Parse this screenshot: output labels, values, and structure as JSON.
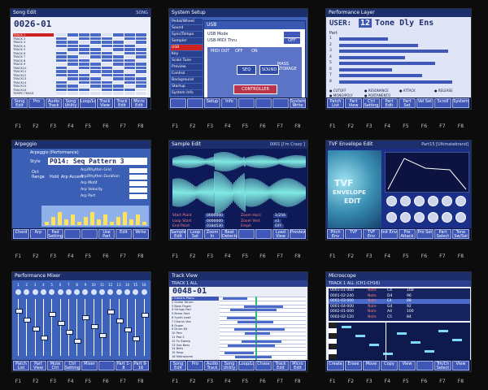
{
  "fkeys": [
    "F1",
    "F2",
    "F3",
    "F4",
    "F5",
    "F6",
    "F7",
    "F8"
  ],
  "song_edit": {
    "title": "Song Edit",
    "status": "SONG",
    "measure": "0026-01",
    "tracks": [
      "TRACK 1",
      "TRACK 2",
      "TRACK 3",
      "TRACK 4",
      "TRACK 5",
      "TRACK 6",
      "TRACK 7",
      "TRACK 8",
      "TRACK 9",
      "TRACK10",
      "TRACK11",
      "TRACK12",
      "TRACK13",
      "TRACK14",
      "TRACK15",
      "TRACK16",
      "TEMPO TRACK"
    ],
    "track_mode": "PLAY",
    "tabs": [
      "Song Edit",
      "Pro",
      "Audio Track",
      "Song Utility",
      "Loop/Locate",
      "Track View",
      "Track Edit",
      "Micro Edit"
    ]
  },
  "system_setup": {
    "title": "System Setup",
    "menu": [
      "Pedal/Wheel",
      "Sound",
      "Sync/Tempo",
      "Sampler",
      "USB",
      "Key",
      "Scale Tune",
      "Preview",
      "Control",
      "Background",
      "Startup",
      "System Info"
    ],
    "heading": "USB",
    "usb_mode_label": "USB Mode",
    "usb_midi_label": "USB-MIDI Thru",
    "off_label": "OFF",
    "on_label": "ON",
    "midi_out_label": "MIDI OUT",
    "midi_in_label": "MIDI IN",
    "storage_label": "MASS STORAGE",
    "seq_label": "SEQ",
    "sound_label": "SOUND",
    "controller_label": "CONTROLLER",
    "tabs": [
      "",
      "",
      "Setup",
      "Info",
      "",
      "",
      "",
      "System Write"
    ]
  },
  "perf_layer": {
    "title": "Performance Layer",
    "bank": "USER:",
    "number": "12",
    "name": "Tone Dly Ens",
    "part_header": "Part",
    "legend": [
      "CUTOFF",
      "RESONANCE",
      "ATTACK",
      "RELEASE",
      "MONO/POLY",
      "PORTAMENTO"
    ],
    "tabs": [
      "Patch List",
      "Part View",
      "Ctrl Setting",
      "Part Edit",
      "Part Set",
      "Vel Set",
      "Scroll",
      "System"
    ]
  },
  "arpeggio": {
    "title": "Arpeggio",
    "subtitle": "Arpeggio (Performance)",
    "style_label": "Style",
    "style_value": "P014: Seq Pattern 3",
    "oct_label": "Oct",
    "range_label": "Range",
    "hold_label": "Hold",
    "accent_label": "Arp Accent",
    "params": [
      "Arp/Rhythm Grid",
      "Arp/Rhythm Duration",
      "Arp Motif",
      "Arp Velocity",
      "Arp Part"
    ],
    "tabs": [
      "Chord",
      "Arp",
      "Pad Setting",
      "",
      "",
      "Use Part",
      "Edit",
      "Write"
    ]
  },
  "sample_edit": {
    "title": "Sample Edit",
    "status": "0001 [I'm Crazy   ]",
    "labels": [
      "Start Point",
      "Loop Start",
      "End Point",
      "Zoom Horz",
      "Zoom Vert",
      "Emph"
    ],
    "values": [
      "0000000",
      "0000000",
      "0184530",
      "1/256",
      "x1",
      "OFF"
    ],
    "tabs": [
      "Sample Edit",
      "Loop Set",
      "Zoom In",
      "Beat Detector",
      "",
      "",
      "Load View",
      "Preview"
    ]
  },
  "tvf_env": {
    "title": "TVF Envelope Edit",
    "status": "Part15  [Ultimatebrand]",
    "bg_text": [
      "TVF",
      "ENVELOPE",
      "EDIT"
    ],
    "tabs": [
      "Pitch Env",
      "TVF",
      "TVF Env",
      "Init Env",
      "Pre Attack",
      "Pro Set",
      "Part Select",
      "Tone Sw/Sel"
    ]
  },
  "perf_mixer": {
    "title": "Performance Mixer",
    "parts": [
      "1",
      "2",
      "3",
      "4",
      "5",
      "6",
      "7",
      "8",
      "9",
      "10",
      "11",
      "12",
      "13",
      "14",
      "15",
      "16"
    ],
    "tabs": [
      "Patch List",
      "Part View",
      "Mute Ctrl",
      "Ctrl Setting",
      "Mixer",
      "",
      "Part 1-8",
      "Part 9-16"
    ]
  },
  "track_view": {
    "title": "Track View",
    "measure": "0048-01",
    "status": "TRACK 1  ALL",
    "tracks": [
      "Electric Piano",
      "Guitar Strum",
      "Bass Finger",
      "Strings Pad",
      "Brass Sect",
      "Synth Lead",
      "Chorus Vox",
      "Organ",
      "Drum Kit",
      "Perc",
      "Pad 2",
      "Fx Sweep",
      "Sub Bass",
      "Bells",
      "Harp",
      "Metronome"
    ],
    "tabs": [
      "Song Edit",
      "Pro",
      "Audio Track",
      "Song Utility",
      "Loop/Locate",
      "Chase",
      "Track Edit",
      "Micro Edit"
    ]
  },
  "microscope": {
    "title": "Microscope",
    "status": "TRACK 1  ALL  (CH1-CH16)",
    "events": [
      {
        "time": "0001-01-000",
        "type": "Note",
        "val": "C4",
        "vel": "100"
      },
      {
        "time": "0001-02-240",
        "type": "Note",
        "val": "D4",
        "vel": "96"
      },
      {
        "time": "0001-03-000",
        "type": "Note",
        "val": "E4",
        "vel": "88"
      },
      {
        "time": "0001-04-000",
        "type": "Note",
        "val": "G4",
        "vel": "92"
      },
      {
        "time": "0002-01-000",
        "type": "Note",
        "val": "A4",
        "vel": "100"
      },
      {
        "time": "0002-02-120",
        "type": "Note",
        "val": "C5",
        "vel": "84"
      }
    ],
    "tabs": [
      "Create",
      "Erase",
      "Move",
      "Copy",
      "View",
      "",
      "Trk/Ch Select",
      "View"
    ]
  }
}
